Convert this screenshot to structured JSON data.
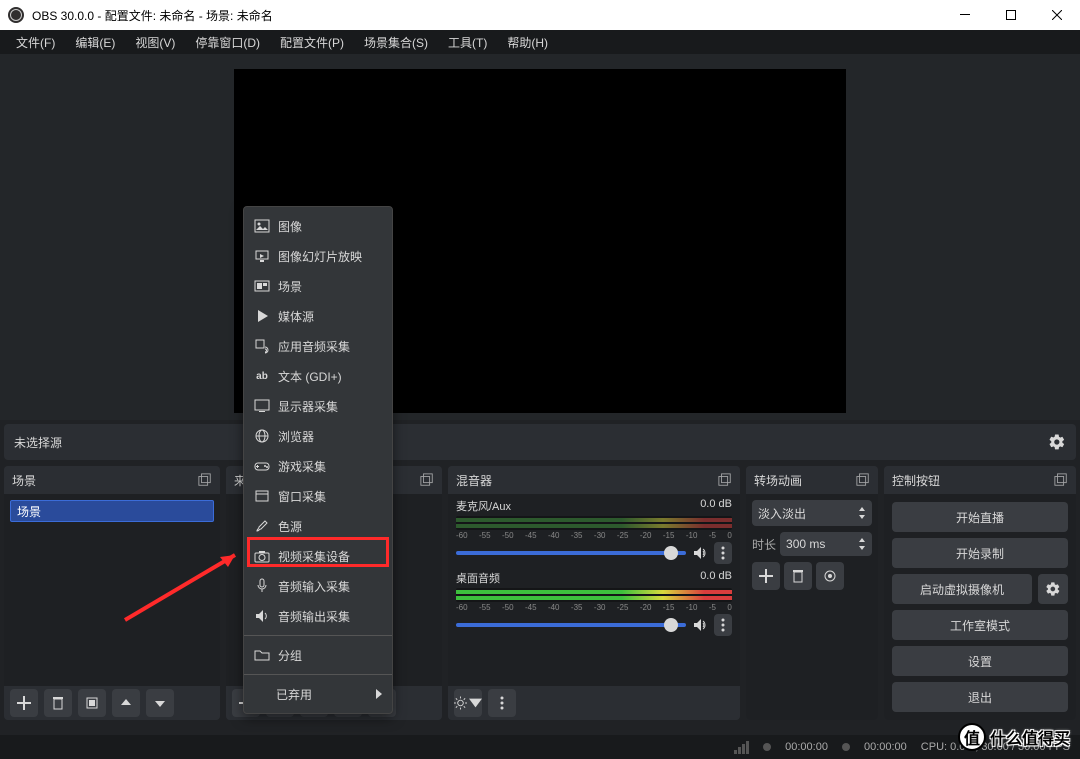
{
  "titlebar": {
    "title": "OBS 30.0.0 - 配置文件: 未命名 - 场景: 未命名"
  },
  "menubar": {
    "items": [
      "文件(F)",
      "编辑(E)",
      "视图(V)",
      "停靠窗口(D)",
      "配置文件(P)",
      "场景集合(S)",
      "工具(T)",
      "帮助(H)"
    ]
  },
  "nosource": {
    "label": "未选择源"
  },
  "docks": {
    "scenes": {
      "title": "场景",
      "items": [
        "场景"
      ]
    },
    "sources": {
      "title": "来"
    },
    "mixer": {
      "title": "混音器",
      "channels": [
        {
          "name": "麦克风/Aux",
          "db": "0.0 dB",
          "ticks": [
            "-60",
            "-55",
            "-50",
            "-45",
            "-40",
            "-35",
            "-30",
            "-25",
            "-20",
            "-15",
            "-10",
            "-5",
            "0"
          ]
        },
        {
          "name": "桌面音频",
          "db": "0.0 dB",
          "ticks": [
            "-60",
            "-55",
            "-50",
            "-45",
            "-40",
            "-35",
            "-30",
            "-25",
            "-20",
            "-15",
            "-10",
            "-5",
            "0"
          ]
        }
      ]
    },
    "transitions": {
      "title": "转场动画",
      "select": "淡入淡出",
      "duration_label": "时长",
      "duration_value": "300 ms"
    },
    "controls": {
      "title": "控制按钮",
      "buttons": [
        "开始直播",
        "开始录制",
        "启动虚拟摄像机",
        "工作室模式",
        "设置",
        "退出"
      ]
    }
  },
  "popup": {
    "items": [
      {
        "icon": "image",
        "label": "图像"
      },
      {
        "icon": "slideshow",
        "label": "图像幻灯片放映"
      },
      {
        "icon": "scene",
        "label": "场景"
      },
      {
        "icon": "media",
        "label": "媒体源"
      },
      {
        "icon": "audio-app",
        "label": "应用音频采集"
      },
      {
        "icon": "text",
        "label": "文本 (GDI+)"
      },
      {
        "icon": "display",
        "label": "显示器采集"
      },
      {
        "icon": "browser",
        "label": "浏览器"
      },
      {
        "icon": "game",
        "label": "游戏采集"
      },
      {
        "icon": "window",
        "label": "窗口采集"
      },
      {
        "icon": "color",
        "label": "色源"
      },
      {
        "icon": "camera",
        "label": "视频采集设备"
      },
      {
        "icon": "mic",
        "label": "音频输入采集"
      },
      {
        "icon": "speaker",
        "label": "音频输出采集"
      }
    ],
    "group": "分组",
    "deprecated": "已弃用"
  },
  "statusbar": {
    "live_time": "00:00:00",
    "rec_time": "00:00:00",
    "stats": "CPU: 0.0%, 30.00 / 30.00 FPS"
  },
  "watermark": {
    "badge": "值",
    "text": "什么值得买"
  }
}
